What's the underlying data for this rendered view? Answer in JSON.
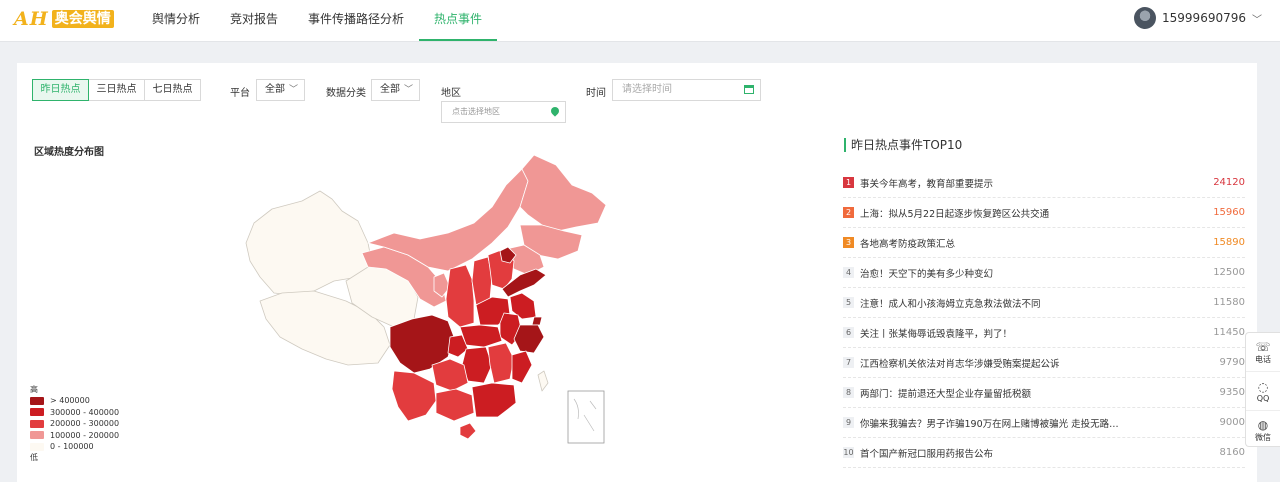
{
  "logo": {
    "latin": "AH",
    "cn": "奥会舆情"
  },
  "nav": [
    {
      "label": "舆情分析",
      "active": false
    },
    {
      "label": "竞对报告",
      "active": false
    },
    {
      "label": "事件传播路径分析",
      "active": false
    },
    {
      "label": "热点事件",
      "active": true
    }
  ],
  "user": {
    "phone": "15999690796"
  },
  "filters": {
    "tabs": [
      "昨日热点",
      "三日热点",
      "七日热点"
    ],
    "active_tab": "昨日热点",
    "platform_label": "平台",
    "platform_value": "全部",
    "category_label": "数据分类",
    "category_value": "全部",
    "region_label": "地区",
    "region_placeholder": "点击选择地区",
    "time_label": "时间",
    "time_placeholder": "请选择时间"
  },
  "map": {
    "title": "区域热度分布图",
    "legend": {
      "high": "高",
      "low": "低",
      "items": [
        {
          "label": "> 400000",
          "color": "#a51518"
        },
        {
          "label": "300000 - 400000",
          "color": "#cc1d22"
        },
        {
          "label": "200000 - 300000",
          "color": "#e23c3e"
        },
        {
          "label": "100000 - 200000",
          "color": "#f09795"
        },
        {
          "label": "0 - 100000",
          "color": "#fdf9f2"
        }
      ]
    }
  },
  "top10": {
    "title": "昨日热点事件TOP10",
    "items": [
      {
        "rank": "1",
        "title": "事关今年高考，教育部重要提示",
        "value": "24120"
      },
      {
        "rank": "2",
        "title": "上海：拟从5月22日起逐步恢复跨区公共交通",
        "value": "15960"
      },
      {
        "rank": "3",
        "title": "各地高考防疫政策汇总",
        "value": "15890"
      },
      {
        "rank": "4",
        "title": "治愈！天空下的美有多少种变幻",
        "value": "12500"
      },
      {
        "rank": "5",
        "title": "注意！成人和小孩海姆立克急救法做法不同",
        "value": "11580"
      },
      {
        "rank": "6",
        "title": "关注丨张某侮辱诋毁袁隆平，判了！",
        "value": "11450"
      },
      {
        "rank": "7",
        "title": "江西检察机关依法对肖志华涉嫌受贿案提起公诉",
        "value": "9790"
      },
      {
        "rank": "8",
        "title": "两部门：提前退还大型企业存量留抵税额",
        "value": "9350"
      },
      {
        "rank": "9",
        "title": "你骗来我骗去？男子诈骗190万在网上赌博被骗光 走投无路…",
        "value": "9000"
      },
      {
        "rank": "10",
        "title": "首个国产新冠口服用药报告公布",
        "value": "8160"
      }
    ]
  },
  "side": {
    "phone": "电话",
    "qq": "QQ",
    "wechat": "微信"
  }
}
